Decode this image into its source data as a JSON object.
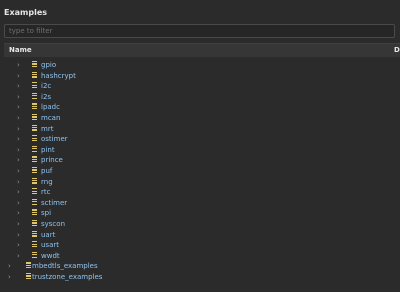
{
  "panel": {
    "title": "Examples",
    "filter_placeholder": "type to filter",
    "filter_value": ""
  },
  "table": {
    "columns": [
      "Name",
      "D"
    ]
  },
  "tree": {
    "children": [
      {
        "label": "gpio"
      },
      {
        "label": "hashcrypt"
      },
      {
        "label": "i2c"
      },
      {
        "label": "i2s"
      },
      {
        "label": "lpadc"
      },
      {
        "label": "mcan"
      },
      {
        "label": "mrt"
      },
      {
        "label": "ostimer"
      },
      {
        "label": "pint"
      },
      {
        "label": "prince"
      },
      {
        "label": "puf"
      },
      {
        "label": "rng"
      },
      {
        "label": "rtc"
      },
      {
        "label": "sctimer"
      },
      {
        "label": "spi"
      },
      {
        "label": "syscon"
      },
      {
        "label": "uart"
      },
      {
        "label": "usart"
      },
      {
        "label": "wwdt"
      }
    ],
    "top_level": [
      {
        "label": "mbedtls_examples"
      },
      {
        "label": "trustzone_examples"
      }
    ]
  },
  "colors": {
    "background": "#2b2b2b",
    "folder_icon": "#e0c86a",
    "label_text": "#8fc4f0",
    "header_bg": "#363636"
  }
}
